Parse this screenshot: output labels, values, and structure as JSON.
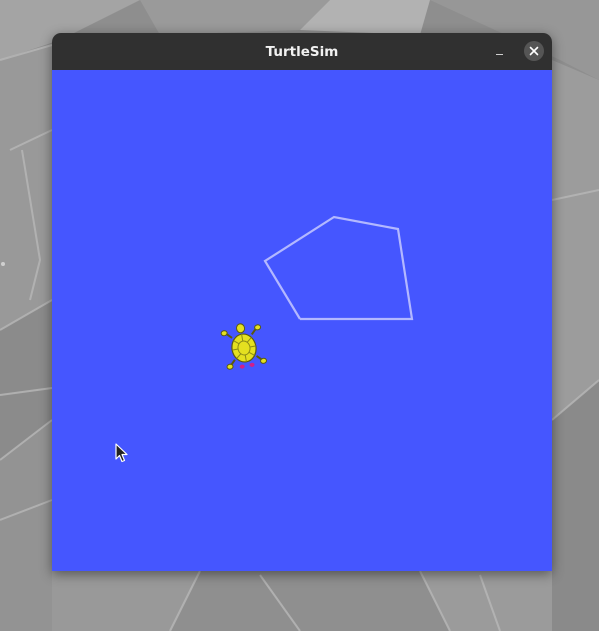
{
  "window": {
    "title": "TurtleSim",
    "minimize_glyph": "–",
    "close_glyph": "×"
  },
  "canvas": {
    "background_color": "#4556ff",
    "pen_color": "#b3b8ff",
    "turtle_color": "#e4e020"
  },
  "icons": {
    "close": "close-icon",
    "minimize": "minimize-icon",
    "cursor": "mouse-pointer-icon",
    "turtle": "turtle-icon"
  }
}
